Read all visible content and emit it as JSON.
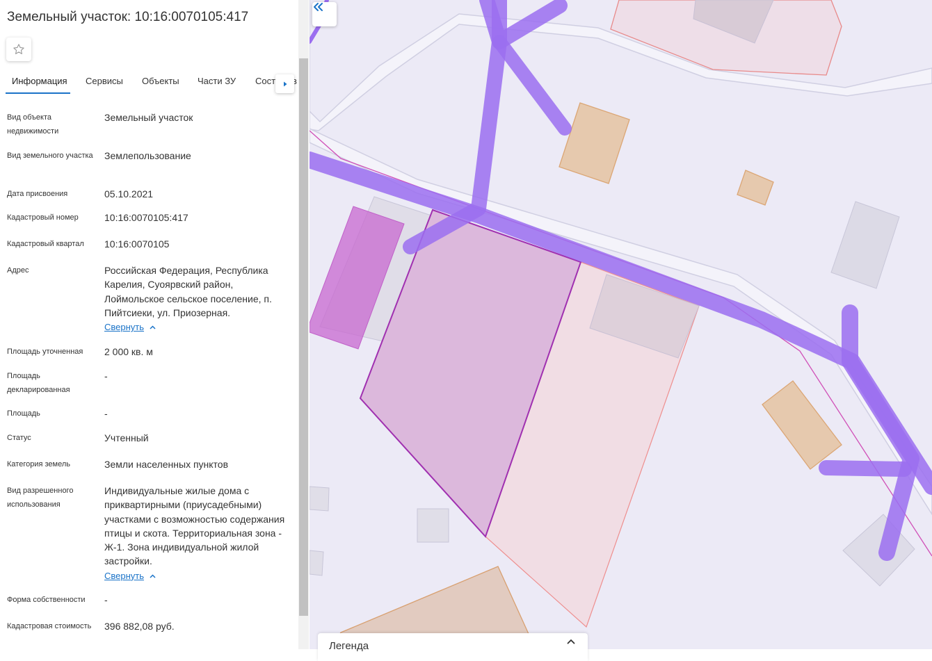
{
  "panel": {
    "title": "Земельный участок: 10:16:0070105:417",
    "favorite_icon": "star-outline-icon",
    "tabs": [
      {
        "label": "Информация",
        "active": true
      },
      {
        "label": "Сервисы",
        "active": false
      },
      {
        "label": "Объекты",
        "active": false
      },
      {
        "label": "Части ЗУ",
        "active": false
      },
      {
        "label": "Сост",
        "active": false
      }
    ],
    "tabs_overflow_text": "в",
    "collapse_label": "Свернуть",
    "fields": [
      {
        "label": "Вид объекта недвижимости",
        "value": "Земельный участок"
      },
      {
        "label": "Вид земельного участка",
        "value": "Землепользование"
      },
      {
        "label": "Дата присвоения",
        "value": "05.10.2021"
      },
      {
        "label": "Кадастровый номер",
        "value": "10:16:0070105:417"
      },
      {
        "label": "Кадастровый квартал",
        "value": "10:16:0070105"
      },
      {
        "label": "Адрес",
        "value": "Российская Федерация, Республика Карелия, Суоярвский район, Лоймольское сельское поселение, п. Пийтсиеки, ул. Приозерная."
      },
      {
        "label": "Площадь уточненная",
        "value": "2 000 кв. м"
      },
      {
        "label": "Площадь декларированная",
        "value": "-"
      },
      {
        "label": "Площадь",
        "value": "-"
      },
      {
        "label": "Статус",
        "value": "Учтенный"
      },
      {
        "label": "Категория земель",
        "value": "Земли населенных пунктов"
      },
      {
        "label": "Вид разрешенного использования",
        "value": "Индивидуальные жилые дома с приквартирными (приусадебными) участками с возможностью содержания птицы и скота. Территориальная зона - Ж-1. Зона индивидуальной жилой застройки."
      },
      {
        "label": "Форма собственности",
        "value": "-"
      },
      {
        "label": "Кадастровая стоимость",
        "value": "396 882,08 руб."
      }
    ]
  },
  "map": {
    "collapse_icon": "double-chevron-left-icon",
    "legend_title": "Легенда",
    "legend_icon": "chevron-up-icon",
    "colors": {
      "background": "#eceaf6",
      "road": "#a57cf2",
      "selected_parcel": "#dcb8dc",
      "selected_outline": "#a030b0",
      "building": "#e6c9ae"
    }
  }
}
